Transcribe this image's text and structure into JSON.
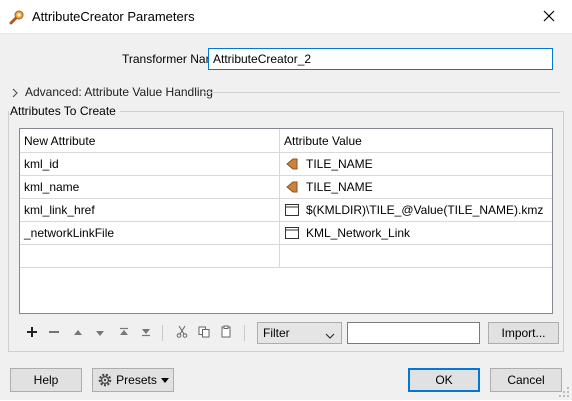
{
  "window": {
    "title": "AttributeCreator Parameters"
  },
  "transformer": {
    "name_label": "Transformer Name:",
    "name_value": "AttributeCreator_2"
  },
  "advanced": {
    "label": "Advanced: Attribute Value Handling"
  },
  "attributes": {
    "group_label": "Attributes To Create",
    "columns": [
      "New Attribute",
      "Attribute Value"
    ],
    "rows": [
      {
        "attribute": "kml_id",
        "value": "TILE_NAME",
        "icon": "attribute-icon"
      },
      {
        "attribute": "kml_name",
        "value": "TILE_NAME",
        "icon": "attribute-icon"
      },
      {
        "attribute": "kml_link_href",
        "value": "$(KMLDIR)\\TILE_@Value(TILE_NAME).kmz",
        "icon": "text-editor-icon"
      },
      {
        "attribute": "_networkLinkFile",
        "value": "KML_Network_Link",
        "icon": "text-editor-icon"
      }
    ]
  },
  "toolbar": {
    "icons": [
      "add-icon",
      "remove-icon",
      "move-up-icon",
      "move-down-icon",
      "move-top-icon",
      "move-bottom-icon",
      "cut-icon",
      "copy-icon",
      "paste-icon"
    ],
    "filter_label": "Filter",
    "filter_text": "",
    "import_label": "Import..."
  },
  "footer": {
    "help_label": "Help",
    "presets_label": "Presets",
    "ok_label": "OK",
    "cancel_label": "Cancel"
  },
  "colors": {
    "accent": "#0078d7",
    "attribute_icon": "#c8843c"
  }
}
